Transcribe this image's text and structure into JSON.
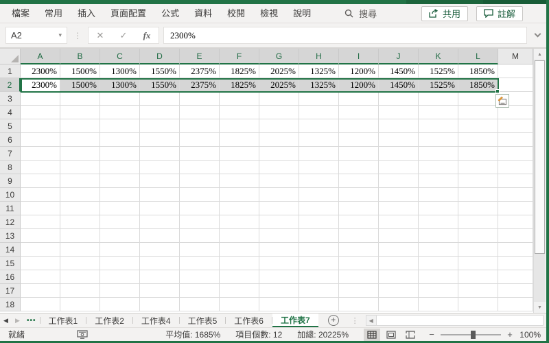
{
  "app": {
    "accent_color": "#217346"
  },
  "menu": {
    "items": [
      "檔案",
      "常用",
      "插入",
      "頁面配置",
      "公式",
      "資料",
      "校閱",
      "檢視",
      "說明"
    ],
    "search_label": "搜尋",
    "share_label": "共用",
    "comments_label": "註解"
  },
  "formula_bar": {
    "name_box": "A2",
    "cancel_icon": "✕",
    "enter_icon": "✓",
    "fx_icon": "fx",
    "formula": "2300%"
  },
  "grid": {
    "column_headers": [
      "A",
      "B",
      "C",
      "D",
      "E",
      "F",
      "G",
      "H",
      "I",
      "J",
      "K",
      "L",
      "M"
    ],
    "row_count": 18,
    "active_cell": "A2",
    "rows": [
      {
        "num": 1,
        "values": [
          "2300%",
          "1500%",
          "1300%",
          "1550%",
          "2375%",
          "1825%",
          "2025%",
          "1325%",
          "1200%",
          "1450%",
          "1525%",
          "1850%"
        ]
      },
      {
        "num": 2,
        "selected": true,
        "values": [
          "2300%",
          "1500%",
          "1300%",
          "1550%",
          "2375%",
          "1825%",
          "2025%",
          "1325%",
          "1200%",
          "1450%",
          "1525%",
          "1850%"
        ]
      }
    ]
  },
  "sheet_tabs": {
    "nav_prev": "◀",
    "nav_next": "▶",
    "ellipsis": "•••",
    "tabs": [
      "工作表1",
      "工作表2",
      "工作表4",
      "工作表5",
      "工作表6",
      "工作表7"
    ],
    "active_tab": "工作表7",
    "add_sheet": "+"
  },
  "status_bar": {
    "ready": "就緒",
    "stats": [
      {
        "label": "平均值",
        "value": "1685%"
      },
      {
        "label": "項目個數",
        "value": "12"
      },
      {
        "label": "加總",
        "value": "20225%"
      }
    ],
    "zoom_minus": "−",
    "zoom_plus": "+",
    "zoom_level": "100%"
  }
}
